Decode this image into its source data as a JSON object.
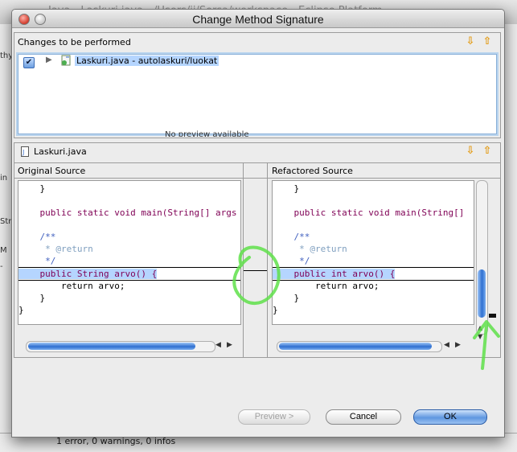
{
  "background_window": {
    "title": "Java - Laskuri.java - /Users/jj/Sorsa/workspace - Eclipse Platform",
    "left_snippets": [
      "thy",
      "in",
      "Str",
      "M",
      "-"
    ],
    "overlapped_text": "No preview available",
    "status_text": "1 error, 0 warnings, 0 infos"
  },
  "dialog": {
    "title": "Change Method Signature",
    "changes_header": "Changes to be performed",
    "tree_item": "Laskuri.java - autolaskuri/luokat",
    "file_label": "Laskuri.java",
    "original_header": "Original Source",
    "refactored_header": "Refactored Source",
    "original_code": [
      "    }",
      "",
      "    public static void main(String[] args",
      "",
      "    /**",
      "     * @return",
      "     */",
      "    public String arvo() {",
      "        return arvo;",
      "    }",
      "}"
    ],
    "refactored_code": [
      "    }",
      "",
      "    public static void main(String[]",
      "",
      "    /**",
      "     * @return",
      "     */",
      "    public int arvo() {",
      "        return arvo;",
      "    }",
      "}"
    ],
    "buttons": {
      "preview": "Preview >",
      "cancel": "Cancel",
      "ok": "OK"
    }
  },
  "colors": {
    "accent": "#3b7fd9",
    "highlight": "#b5d5ff",
    "keyword": "#7f0055",
    "annotation_green": "#5fe04a"
  }
}
